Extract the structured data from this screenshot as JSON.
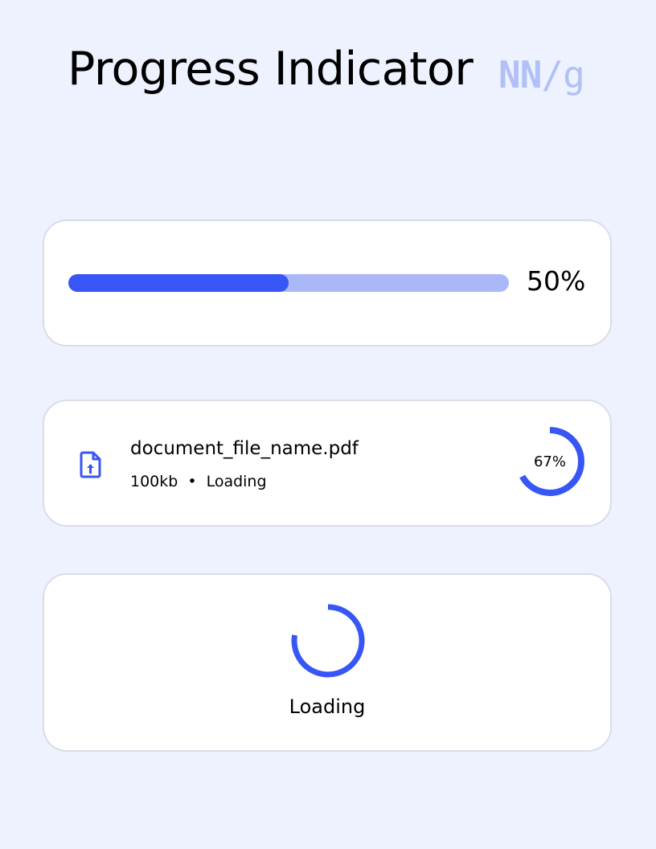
{
  "header": {
    "title": "Progress Indicator",
    "logo": {
      "letters": "NN",
      "slash": "/",
      "g": "g"
    }
  },
  "linear_progress": {
    "percent_label": "50%",
    "value": 0.5
  },
  "file_upload": {
    "icon": "file-upload-icon",
    "file_name": "document_file_name.pdf",
    "size": "100kb",
    "separator": "•",
    "status": "Loading",
    "percent_label": "67%",
    "value": 0.67
  },
  "spinner": {
    "label": "Loading"
  },
  "colors": {
    "background": "#edf2fe",
    "accent": "#3756f5",
    "accent_light": "#aab8f8",
    "logo": "#b1c0f7",
    "card_border": "#dadde6"
  }
}
